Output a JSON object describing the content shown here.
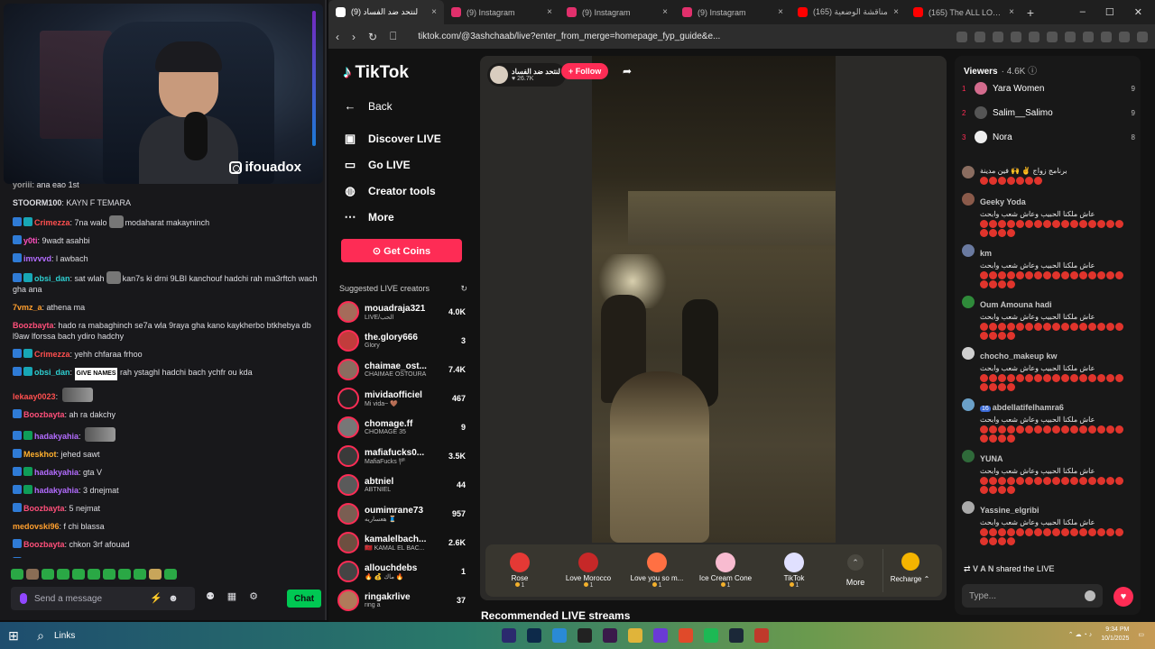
{
  "overlay": {
    "cam_handle": "ifouadox",
    "chat": [
      {
        "user": "yoriii",
        "text": "ana eao 1st",
        "color": "#9a9a9a",
        "badges": []
      },
      {
        "user": "STOORM100",
        "text": "KAYN F TEMARA",
        "color": "#dedee3",
        "badges": [],
        "plain": true
      },
      {
        "user": "Crimezza",
        "text": "7na walo",
        "text2": "modaharat makayninch",
        "color": "#ff4f4f",
        "badges": [
          "b-blue",
          "b-teal"
        ],
        "emote": true
      },
      {
        "user": "y0ti",
        "text": "9wadt asahbi",
        "color": "#ff4fbf",
        "badges": [
          "b-blue"
        ]
      },
      {
        "user": "imvvvd",
        "text": "l awbach",
        "color": "#b36cff",
        "badges": [
          "b-blue"
        ]
      },
      {
        "user": "obsi_dan",
        "text": "sat wlah",
        "text2": "kan7s ki drni 9LBI kanchouf hadchi rah ma3rftch wach gha ana",
        "color": "#2ecfd1",
        "badges": [
          "b-blue",
          "b-teal"
        ],
        "emote": true
      },
      {
        "user": "7vmz_a",
        "text": "athena ma",
        "color": "#ff9f2e",
        "badges": []
      },
      {
        "user": "Boozbayta",
        "text": "hado ra mabaghinch se7a wla 9raya gha kano kaykherbo btkhebya db l9aw lforssa bach ydiro hadchy",
        "color": "#ff4f7a",
        "badges": []
      },
      {
        "user": "Crimezza",
        "text": "yehh chfaraa frhoo",
        "color": "#ff4f4f",
        "badges": [
          "b-blue",
          "b-teal"
        ]
      },
      {
        "user": "obsi_dan",
        "text": "rah ystaghl hadchi bach ychfr ou kda",
        "tag": "GIVE NAMES",
        "color": "#2ecfd1",
        "badges": [
          "b-blue",
          "b-teal"
        ]
      },
      {
        "user": "lekaay0023",
        "text": "",
        "color": "#ff4f4f",
        "badges": [],
        "wideemote": true
      },
      {
        "user": "Boozbayta",
        "text": "ah ra dakchy",
        "color": "#ff4f7a",
        "badges": [
          "b-blue"
        ]
      },
      {
        "user": "hadakyahia",
        "text": "",
        "color": "#b36cff",
        "badges": [
          "b-blue",
          "b-green"
        ],
        "wideemote": true
      },
      {
        "user": "Meskhot",
        "text": "jehed sawt",
        "color": "#ffb02e",
        "badges": [
          "b-blue"
        ]
      },
      {
        "user": "hadakyahia",
        "text": "gta V",
        "color": "#b36cff",
        "badges": [
          "b-blue",
          "b-green"
        ]
      },
      {
        "user": "hadakyahia",
        "text": "3 dnejmat",
        "color": "#b36cff",
        "badges": [
          "b-blue",
          "b-green"
        ]
      },
      {
        "user": "Boozbayta",
        "text": "5 nejmat",
        "color": "#ff4f7a",
        "badges": [
          "b-blue"
        ]
      },
      {
        "user": "medovski96",
        "text": "f chi blassa",
        "color": "#ff9f2e",
        "badges": []
      },
      {
        "user": "Boozbayta",
        "text": "chkon 3rf afouad",
        "color": "#ff4f7a",
        "badges": [
          "b-blue"
        ]
      },
      {
        "user": "Boozbayta",
        "text": "b7alna b7alk",
        "color": "#ff4f7a",
        "badges": [
          "b-blue"
        ]
      }
    ],
    "input_placeholder": "Send a message",
    "chat_button": "Chat"
  },
  "browser": {
    "tabs": [
      {
        "label": "لنتحد ضد الفساد (9)",
        "icon": "tiktok-icon",
        "color": "#ffffff",
        "active": true
      },
      {
        "label": "(9) Instagram",
        "icon": "instagram-icon",
        "color": "#e1306c"
      },
      {
        "label": "(9) Instagram",
        "icon": "instagram-icon",
        "color": "#e1306c"
      },
      {
        "label": "(9) Instagram",
        "icon": "instagram-icon",
        "color": "#e1306c"
      },
      {
        "label": "(165) مناقشة الوضعية",
        "icon": "youtube-icon",
        "color": "#ff0000"
      },
      {
        "label": "(165) The ALL LOGITECH G",
        "icon": "youtube-icon",
        "color": "#ff0000"
      }
    ],
    "url": "tiktok.com/@3ashchaab/live?enter_from_merge=homepage_fyp_guide&e..."
  },
  "tiktok": {
    "brand": "TikTok",
    "nav": {
      "back": "Back",
      "discover": "Discover LIVE",
      "go_live": "Go LIVE",
      "creator_tools": "Creator tools",
      "more": "More"
    },
    "get_coins": "Get Coins",
    "suggested_title": "Suggested LIVE creators",
    "creators": [
      {
        "name": "mouadraja321",
        "sub": "LIVE/الحب",
        "count": "4.0K",
        "color": "#a56b5a"
      },
      {
        "name": "the.glory666",
        "sub": "Glory",
        "count": "3",
        "color": "#c23c3c"
      },
      {
        "name": "chaimae_ost...",
        "sub": "CHAIMAE OSTOURA",
        "count": "7.4K",
        "color": "#8a6d60"
      },
      {
        "name": "mividaofficiel",
        "sub": "Mi vida~ 🤎",
        "count": "467",
        "color": "#222222"
      },
      {
        "name": "chomage.ff",
        "sub": "CHOMAGE 35",
        "count": "9",
        "color": "#777777"
      },
      {
        "name": "mafiafucks0...",
        "sub": "MafiaFucks 🏴",
        "count": "3.5K",
        "color": "#3a3a3a"
      },
      {
        "name": "abtniel",
        "sub": "ABTNIEL",
        "count": "44",
        "color": "#5a5a5a"
      },
      {
        "name": "oumimrane73",
        "sub": "ه‍عساريه 🧵",
        "count": "957",
        "color": "#7a5e52"
      },
      {
        "name": "kamalelbach...",
        "sub": "🇲🇦 KAMAL EL BAC...",
        "count": "2.6K",
        "color": "#6d4f40"
      },
      {
        "name": "allouchdebs",
        "sub": "🔥 💰 ماك 🔥",
        "count": "1",
        "color": "#444444"
      },
      {
        "name": "ringakrlive",
        "sub": "ring a",
        "count": "37",
        "color": "#b07a5a"
      }
    ],
    "host": {
      "name": "لنتحد ضد الفساد",
      "likes": "26.7K"
    },
    "follow": "+ Follow",
    "gifts": [
      {
        "name": "Rose",
        "cost": "1",
        "color": "#e53935"
      },
      {
        "name": "Love Morocco",
        "cost": "1",
        "color": "#c62828"
      },
      {
        "name": "Love you so m...",
        "cost": "1",
        "color": "#ff7043"
      },
      {
        "name": "Ice Cream Cone",
        "cost": "1",
        "color": "#f8bbd0"
      },
      {
        "name": "TikTok",
        "cost": "1",
        "color": "#e0e0ff"
      }
    ],
    "gift_more": "More",
    "recharge": "Recharge ⌃",
    "recommended_title": "Recommended LIVE streams",
    "viewers": {
      "label": "Viewers",
      "count": "4.6K",
      "top": [
        {
          "rank": "1",
          "name": "Yara Women",
          "score": "9",
          "color": "#d36b8d"
        },
        {
          "rank": "2",
          "name": "Salim__Salimo",
          "score": "9",
          "color": "#555555"
        },
        {
          "rank": "3",
          "name": "Nora",
          "score": "8",
          "color": "#eeeeee"
        }
      ]
    },
    "live_chat": [
      {
        "user": "",
        "text": "برنامج زواج ✌️ 🙌 فين مدينة",
        "dots": 7,
        "color": "#8a6d60"
      },
      {
        "user": "Geeky Yoda",
        "text": "عاش ملكنا الحبيب وعاش شعب وابحث",
        "dots": 20,
        "color": "#8a5a4a"
      },
      {
        "user": "km",
        "text": "عاش ملكنا الحبيب وعاش شعب وابحث",
        "dots": 20,
        "color": "#6a7aa0"
      },
      {
        "user": "Oum Amouna hadi",
        "text": "عاش ملكنا الحبيب وعاش شعب وابحث",
        "dots": 20,
        "color": "#2f8a3a"
      },
      {
        "user": "chocho_makeup kw",
        "text": "عاش ملكنا الحبيب وعاش شعب وابحث",
        "dots": 20,
        "color": "#cfcfcf"
      },
      {
        "user": "abdellatifelhamra6",
        "text": "عاش ملكنا الحبيب وعاش شعب وابحث",
        "dots": 20,
        "color": "#6aa0c8",
        "badge": "16"
      },
      {
        "user": "YUNA",
        "text": "عاش ملكنا الحبيب وعاش شعب وابحث",
        "dots": 20,
        "color": "#2f6a3a"
      },
      {
        "user": "Yassine_elgribi",
        "text": "عاش ملكنا الحبيب وعاش شعب وابحث",
        "dots": 20,
        "color": "#aaaaaa"
      }
    ],
    "shared_user": "V A N",
    "shared_text": "shared the LIVE",
    "type_placeholder": "Type..."
  },
  "taskbar": {
    "links": "Links",
    "time": "9:34 PM",
    "date": "10/1/2025"
  }
}
